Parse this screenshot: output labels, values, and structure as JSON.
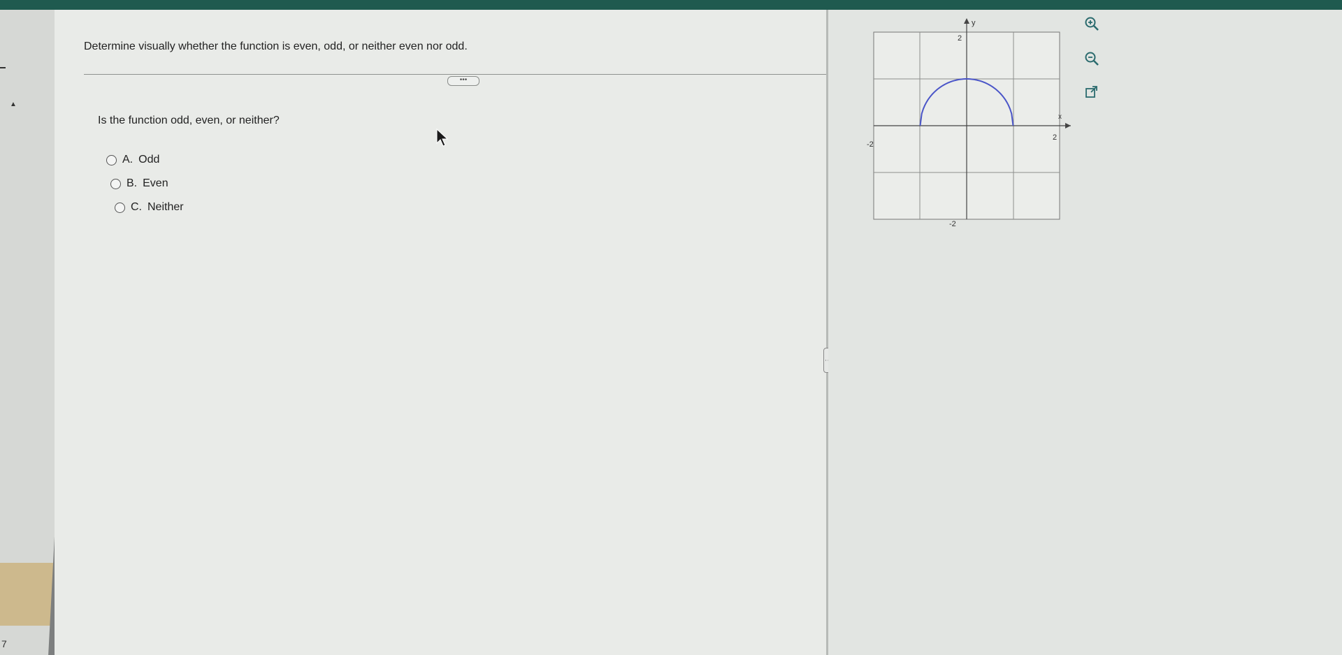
{
  "question": {
    "instruction": "Determine visually whether the function is even, odd, or neither even nor odd.",
    "more_label": "•••",
    "prompt": "Is the function odd, even, or neither?",
    "options": [
      {
        "letter": "A.",
        "label": "Odd"
      },
      {
        "letter": "B.",
        "label": "Even"
      },
      {
        "letter": "C.",
        "label": "Neither"
      }
    ]
  },
  "graph": {
    "x_axis_label": "x",
    "y_axis_label": "y",
    "x_tick_pos": "2",
    "x_tick_neg": "-2",
    "y_tick_pos": "2",
    "y_tick_neg": "-2",
    "xlim": [
      -2,
      2
    ],
    "ylim": [
      -2,
      2
    ],
    "curve_color": "#4a55c8",
    "curve": "upper semicircle centered at origin, radius 1, for x in [-1, 1]"
  },
  "tools": {
    "zoom_in_icon": "zoom-in-icon",
    "zoom_out_icon": "zoom-out-icon",
    "popout_icon": "external-link-icon"
  },
  "sidebar": {
    "page_marker": "7"
  },
  "colors": {
    "topbar": "#1f5a4f",
    "accent": "#4a55c8"
  }
}
